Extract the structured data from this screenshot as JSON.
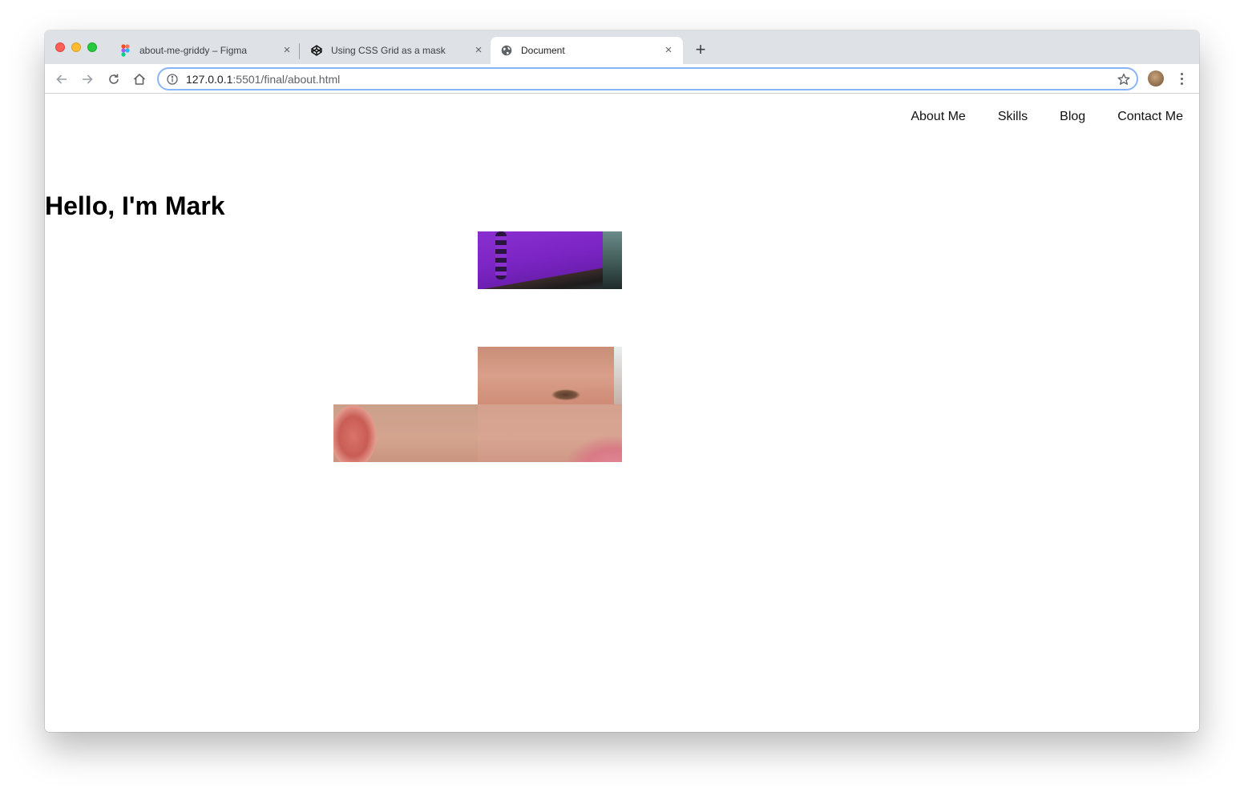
{
  "browser": {
    "tabs": [
      {
        "title": "about-me-griddy – Figma",
        "icon": "figma-icon",
        "active": false
      },
      {
        "title": "Using CSS Grid as a mask",
        "icon": "codepen-icon",
        "active": false
      },
      {
        "title": "Document",
        "icon": "globe-icon",
        "active": true
      }
    ],
    "tab_close_glyph": "×",
    "new_tab_glyph": "+",
    "url": {
      "host": "127.0.0.1",
      "rest": ":5501/final/about.html"
    }
  },
  "site": {
    "nav": [
      {
        "label": "About Me"
      },
      {
        "label": "Skills"
      },
      {
        "label": "Blog"
      },
      {
        "label": "Contact Me"
      }
    ],
    "heading": "Hello, I'm Mark"
  },
  "colors": {
    "tabstrip": "#dee1e6",
    "omnibox_border": "#8ab4f8",
    "hat_purple": "#8a2fd0"
  }
}
